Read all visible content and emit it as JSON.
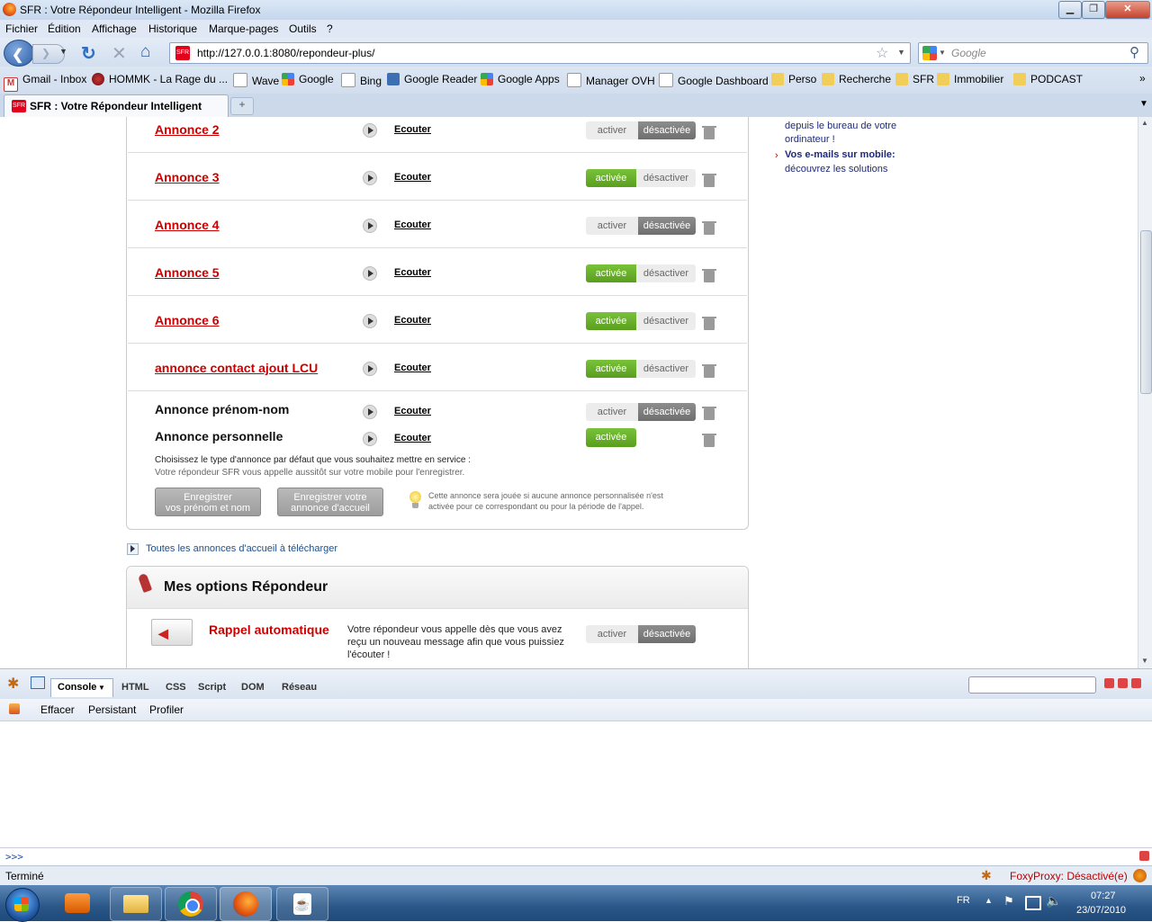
{
  "window": {
    "title": "SFR : Votre Répondeur Intelligent - Mozilla Firefox"
  },
  "menu": [
    "Fichier",
    "Édition",
    "Affichage",
    "Historique",
    "Marque-pages",
    "Outils",
    "?"
  ],
  "url": "http://127.0.0.1:8080/repondeur-plus/",
  "search_placeholder": "Google",
  "bookmarks": [
    "Gmail - Inbox",
    "HOMMK - La Rage du ...",
    "Wave",
    "Google",
    "Bing",
    "Google Reader",
    "Google Apps",
    "Manager OVH",
    "Google Dashboard",
    "Perso",
    "Recherche",
    "SFR",
    "Immobilier",
    "PODCAST"
  ],
  "tab": {
    "label": "SFR : Votre Répondeur Intelligent"
  },
  "sidebar": {
    "line1": "depuis le bureau de votre",
    "line2": "ordinateur !",
    "link_title": "Vos e-mails sur mobile:",
    "link_sub": "découvrez les solutions"
  },
  "announcements": [
    {
      "name": "Annonce 2",
      "listen": "Ecouter",
      "active": false
    },
    {
      "name": "Annonce 3",
      "listen": "Ecouter",
      "active": true
    },
    {
      "name": "Annonce 4",
      "listen": "Ecouter",
      "active": false
    },
    {
      "name": "Annonce 5",
      "listen": "Ecouter",
      "active": true
    },
    {
      "name": "Annonce 6",
      "listen": "Ecouter",
      "active": true
    },
    {
      "name": "annonce contact ajout LCU",
      "listen": "Ecouter",
      "active": true
    }
  ],
  "toggle": {
    "activer": "activer",
    "activee": "activée",
    "desactiver": "désactiver",
    "desactivee": "désactivée"
  },
  "prenom_nom": {
    "name": "Annonce prénom-nom",
    "listen": "Ecouter"
  },
  "personnelle": {
    "name": "Annonce personnelle",
    "listen": "Ecouter",
    "state": "activée"
  },
  "choose_text": "Choisissez le type d'annonce par défaut que vous souhaitez mettre en service :",
  "choose_sub": "Votre répondeur SFR vous appelle aussitôt sur votre mobile pour l'enregistrer.",
  "btn_record_name": {
    "l1": "Enregistrer",
    "l2": "vos prénom et nom"
  },
  "btn_record_welcome": {
    "l1": "Enregistrer votre",
    "l2": "annonce d'accueil"
  },
  "tip": {
    "l1": "Cette annonce sera jouée si aucune annonce personnalisée n'est",
    "l2": "activée pour ce correspondant ou pour la période de l'appel."
  },
  "download_link": "Toutes les annonces d'accueil à télécharger",
  "options": {
    "title": "Mes options Répondeur",
    "rappel_title": "Rappel automatique",
    "rappel_l1": "Votre répondeur vous appelle dès que vous avez",
    "rappel_l2": "reçu un nouveau message afin que vous puissiez",
    "rappel_l3": "l'écouter !",
    "toggle_left": "activer",
    "toggle_right": "désactivée"
  },
  "firebug": {
    "tabs": [
      "Console",
      "HTML",
      "CSS",
      "Script",
      "DOM",
      "Réseau"
    ],
    "subtabs": [
      "Effacer",
      "Persistant",
      "Profiler"
    ],
    "prompt": ">>>"
  },
  "status": {
    "left": "Terminé",
    "right": "FoxyProxy: Désactivé(e)"
  },
  "taskbar": {
    "lang": "FR",
    "time": "07:27",
    "date": "23/07/2010"
  }
}
